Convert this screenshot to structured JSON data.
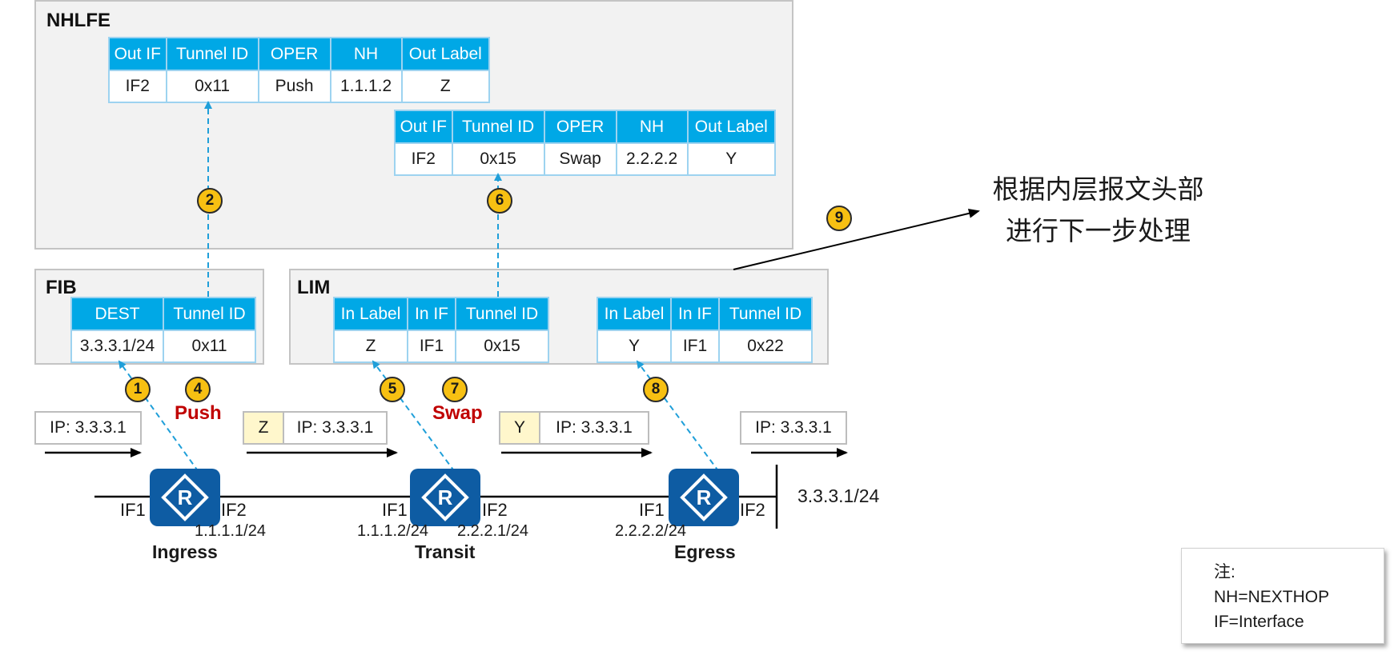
{
  "nhlfe": {
    "title": "NHLFE",
    "table1": {
      "headers": [
        "Out IF",
        "Tunnel ID",
        "OPER",
        "NH",
        "Out Label"
      ],
      "row": [
        "IF2",
        "0x11",
        "Push",
        "1.1.1.2",
        "Z"
      ]
    },
    "table2": {
      "headers": [
        "Out IF",
        "Tunnel ID",
        "OPER",
        "NH",
        "Out Label"
      ],
      "row": [
        "IF2",
        "0x15",
        "Swap",
        "2.2.2.2",
        "Y"
      ]
    }
  },
  "fib": {
    "title": "FIB",
    "table": {
      "headers": [
        "DEST",
        "Tunnel ID"
      ],
      "row": [
        "3.3.3.1/24",
        "0x11"
      ]
    }
  },
  "lim": {
    "title": "LIM",
    "table1": {
      "headers": [
        "In Label",
        "In IF",
        "Tunnel ID"
      ],
      "row": [
        "Z",
        "IF1",
        "0x15"
      ]
    },
    "table2": {
      "headers": [
        "In Label",
        "In IF",
        "Tunnel ID"
      ],
      "row": [
        "Y",
        "IF1",
        "0x22"
      ]
    }
  },
  "steps": [
    "1",
    "2",
    "4",
    "5",
    "6",
    "7",
    "8",
    "9"
  ],
  "operations": {
    "push": "Push",
    "swap": "Swap"
  },
  "packets": {
    "p1": {
      "ip": "IP: 3.3.3.1"
    },
    "p2": {
      "label": "Z",
      "ip": "IP: 3.3.3.1"
    },
    "p3": {
      "label": "Y",
      "ip": "IP: 3.3.3.1"
    },
    "p4": {
      "ip": "IP: 3.3.3.1"
    }
  },
  "routers": {
    "ingress": {
      "name": "Ingress",
      "if1": "IF1",
      "if2": "IF2",
      "if2_addr": "1.1.1.1/24"
    },
    "transit": {
      "name": "Transit",
      "if1": "IF1",
      "if2": "IF2",
      "if1_addr": "1.1.1.2/24",
      "if2_addr": "2.2.2.1/24"
    },
    "egress": {
      "name": "Egress",
      "if1": "IF1",
      "if2": "IF2",
      "if1_addr": "2.2.2.2/24"
    }
  },
  "dest_network": "3.3.3.1/24",
  "inner_process": {
    "line1": "根据内层报文头部",
    "line2": "进行下一步处理"
  },
  "note": {
    "title": "注:",
    "line1": "NH=NEXTHOP",
    "line2": "IF=Interface"
  },
  "colors": {
    "table_header": "#00a8e6",
    "table_border": "#9dd3f0",
    "panel_bg": "#f2f2f2",
    "badge": "#f7c012",
    "operation_text": "#c00000",
    "router": "#0e5ca3",
    "dashed_arrow": "#1f9fd9",
    "label_fill": "#fff7cc"
  },
  "icons": [
    "router-icon",
    "arrow-right-icon",
    "dashed-arrow-icon"
  ]
}
